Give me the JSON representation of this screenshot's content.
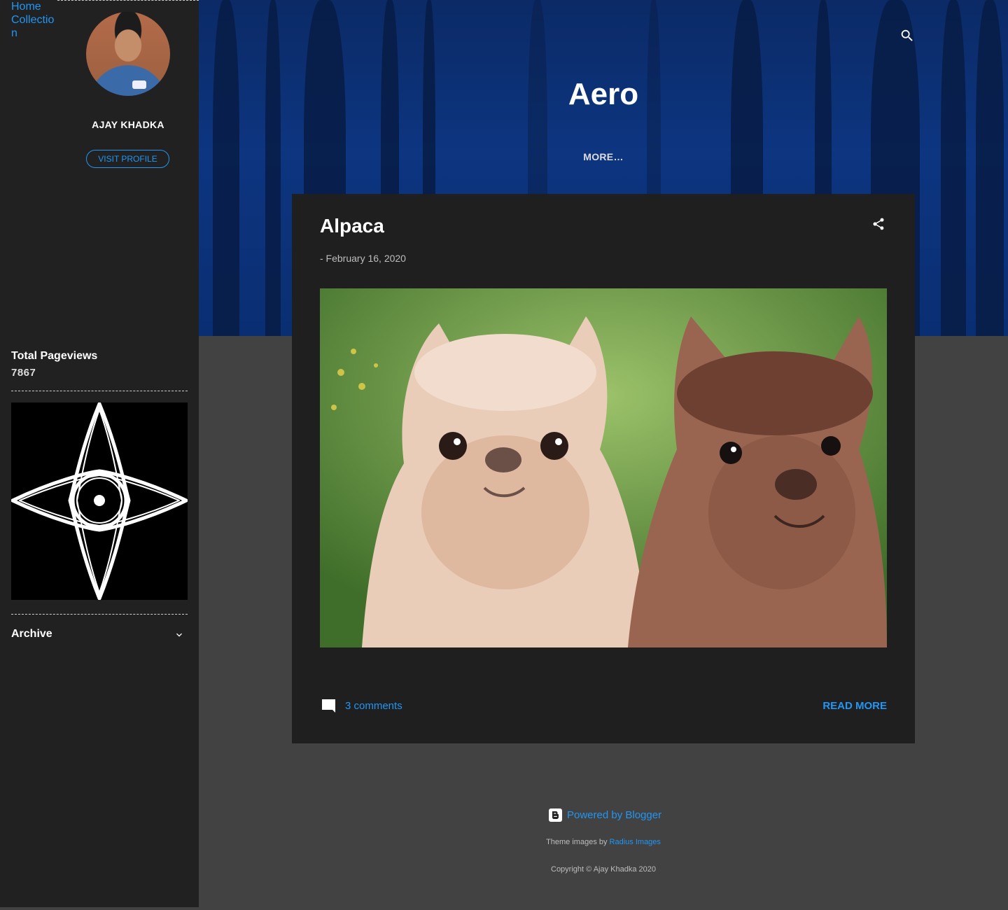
{
  "nav": {
    "home_label": "Home",
    "collection_label": "Collection"
  },
  "profile": {
    "name": "AJAY KHADKA",
    "visit_label": "VISIT PROFILE"
  },
  "sidebar": {
    "pageviews_title": "Total Pageviews",
    "pageviews_count": "7867",
    "archive_label": "Archive"
  },
  "header": {
    "blog_title": "Aero",
    "more_label": "MORE…"
  },
  "post": {
    "title": "Alpaca",
    "date": "- February 16, 2020",
    "comments_label": "3 comments",
    "read_more_label": "READ MORE"
  },
  "footer": {
    "powered_label": "Powered by Blogger",
    "theme_prefix": "Theme images by ",
    "theme_credit": "Radius Images",
    "copyright": "Copyright © Ajay Khadka 2020"
  },
  "colors": {
    "accent": "#2196f3",
    "sidebar_bg": "#212121",
    "page_bg": "#424242",
    "card_bg": "#1f1f1f",
    "header_bg": "#0d3580"
  },
  "icons": {
    "search": "search-icon",
    "share": "share-icon",
    "comment": "comment-icon",
    "archive_toggle": "chevron-down-icon",
    "blogger": "blogger-logo-icon"
  }
}
